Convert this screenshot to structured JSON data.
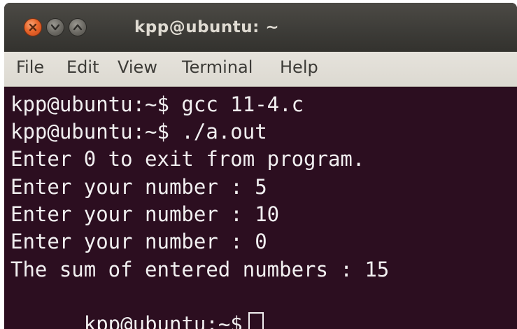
{
  "window": {
    "title": "kpp@ubuntu: ~"
  },
  "controls": {
    "close_icon": "close-icon",
    "minimize_icon": "minimize-icon",
    "maximize_icon": "maximize-icon"
  },
  "menu": {
    "items": [
      "File",
      "Edit",
      "View",
      "Terminal",
      "Help"
    ]
  },
  "terminal": {
    "prompt": "kpp@ubuntu:~$ ",
    "lines": [
      "kpp@ubuntu:~$ gcc 11-4.c",
      "kpp@ubuntu:~$ ./a.out",
      "Enter 0 to exit from program.",
      "Enter your number : 5",
      "Enter your number : 10",
      "Enter your number : 0",
      "The sum of entered numbers : 15"
    ],
    "current_prompt": "kpp@ubuntu:~$"
  },
  "colors": {
    "terminal_bg": "#2c0e20",
    "terminal_fg": "#f1eff0",
    "titlebar_bg": "#3c3b37",
    "menubar_bg": "#e0ddd6",
    "close_button": "#e9672b"
  }
}
